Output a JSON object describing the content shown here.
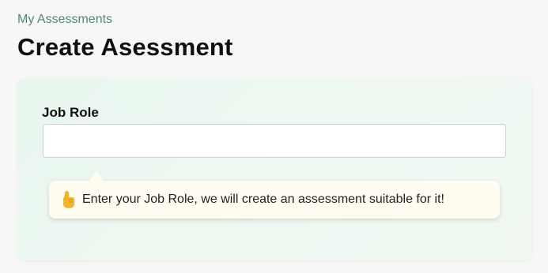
{
  "breadcrumb": {
    "label": "My Assessments"
  },
  "page": {
    "title": "Create Asessment"
  },
  "form": {
    "job_role_label": "Job Role",
    "job_role_value": "",
    "job_role_placeholder": ""
  },
  "tooltip": {
    "icon": "pointing-up-hand-icon",
    "text": "Enter your Job Role, we will create an assessment suitable for it!"
  },
  "colors": {
    "breadcrumb": "#4f8a78",
    "card_background": "#e8f6ee",
    "tooltip_background": "#fffdf1",
    "hand_icon": "#f3b62a"
  }
}
